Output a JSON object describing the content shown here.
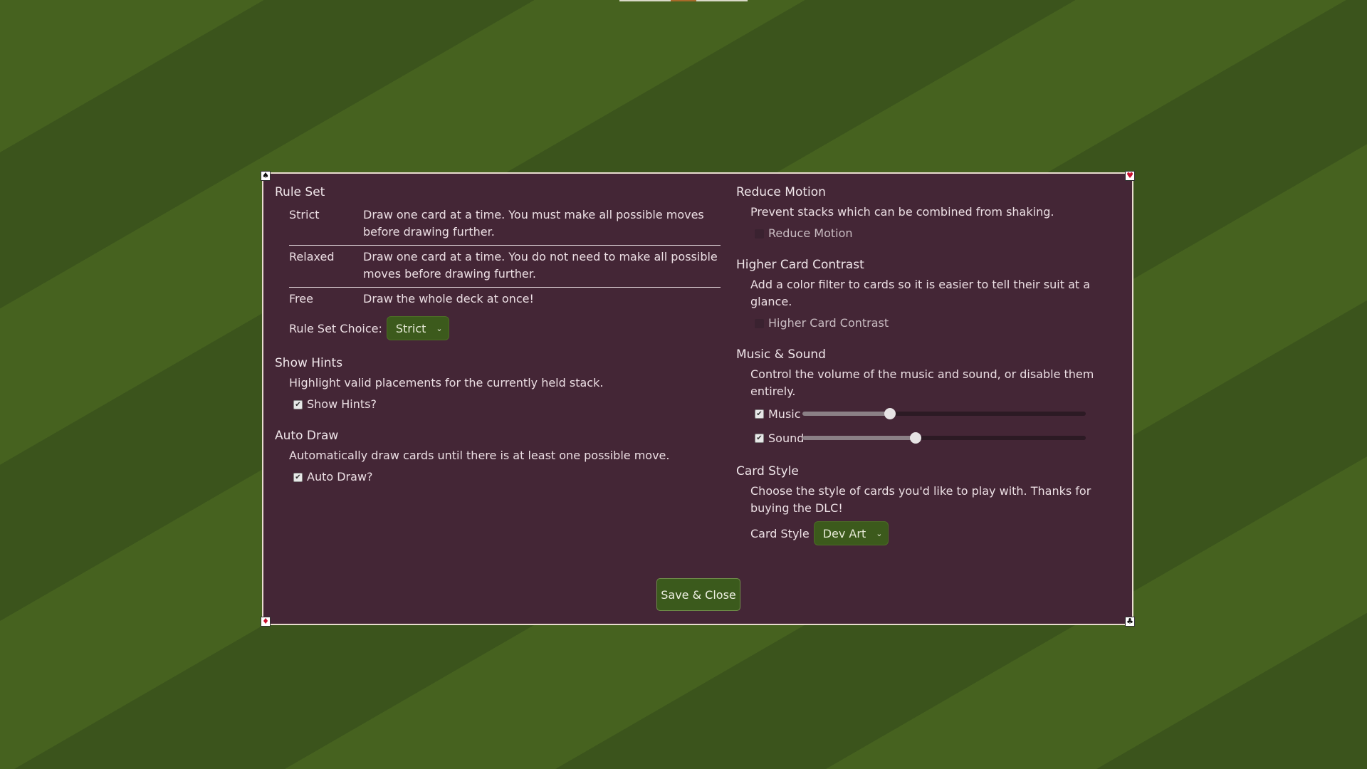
{
  "rule_set": {
    "title": "Rule Set",
    "rules": [
      {
        "name": "Strict",
        "description": "Draw one card at a time. You must make all possible moves before drawing further."
      },
      {
        "name": "Relaxed",
        "description": "Draw one card at a time. You do not need to make all possible moves before drawing further."
      },
      {
        "name": "Free",
        "description": "Draw the whole deck at once!"
      }
    ],
    "choice_label": "Rule Set Choice:",
    "choice_value": "Strict"
  },
  "show_hints": {
    "title": "Show Hints",
    "description": "Highlight valid placements for the currently held stack.",
    "checkbox_label": "Show Hints?",
    "checked": true
  },
  "auto_draw": {
    "title": "Auto Draw",
    "description": "Automatically draw cards until there is at least one possible move.",
    "checkbox_label": "Auto Draw?",
    "checked": true
  },
  "reduce_motion": {
    "title": "Reduce Motion",
    "description": "Prevent stacks which can be combined from shaking.",
    "checkbox_label": "Reduce Motion",
    "checked": false
  },
  "higher_contrast": {
    "title": "Higher Card Contrast",
    "description": "Add a color filter to cards so it is easier to tell their suit at a glance.",
    "checkbox_label": "Higher Card Contrast",
    "checked": false
  },
  "music_sound": {
    "title": "Music & Sound",
    "description": "Control the volume of the music and sound, or disable them entirely.",
    "music_label": "Music",
    "music_enabled": true,
    "music_level": 0.31,
    "sound_label": "Sound",
    "sound_enabled": true,
    "sound_level": 0.4
  },
  "card_style": {
    "title": "Card Style",
    "description": "Choose the style of cards you'd like to play with. Thanks for buying the DLC!",
    "choice_label": "Card Style",
    "choice_value": "Dev Art"
  },
  "save_close_label": "Save & Close",
  "corner_suits": {
    "top_left": "♠",
    "top_right": "♥",
    "bottom_left": "♦",
    "bottom_right": "♣"
  },
  "colors": {
    "panel": "#442636",
    "felt_dark": "#3b541c",
    "felt_light": "#46621f",
    "button": "#3b5a1c"
  }
}
